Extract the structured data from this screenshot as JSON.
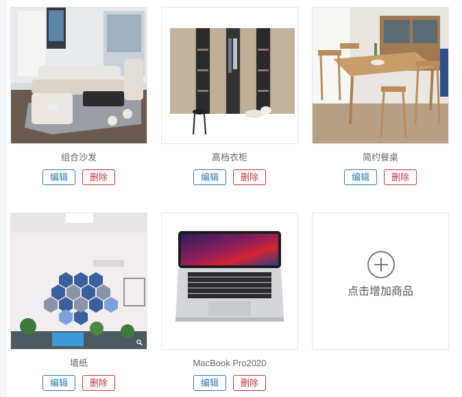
{
  "products": [
    {
      "name": "组合沙发",
      "image_icon": "sofa-photo",
      "edit_label": "编辑",
      "delete_label": "删除"
    },
    {
      "name": "高档衣柜",
      "image_icon": "wardrobe-photo",
      "edit_label": "编辑",
      "delete_label": "删除"
    },
    {
      "name": "简约餐桌",
      "image_icon": "dining-table-photo",
      "edit_label": "编辑",
      "delete_label": "删除"
    },
    {
      "name": "墙纸",
      "image_icon": "wallpaper-photo",
      "edit_label": "编辑",
      "delete_label": "删除"
    },
    {
      "name": "MacBook Pro2020",
      "image_icon": "laptop-photo",
      "edit_label": "编辑",
      "delete_label": "删除"
    }
  ],
  "add_product": {
    "label": "点击增加商品",
    "icon": "plus-circle-icon"
  },
  "colors": {
    "edit": "#2e7bb0",
    "delete": "#c9343d",
    "text": "#666666",
    "border": "#e6e6e6"
  }
}
